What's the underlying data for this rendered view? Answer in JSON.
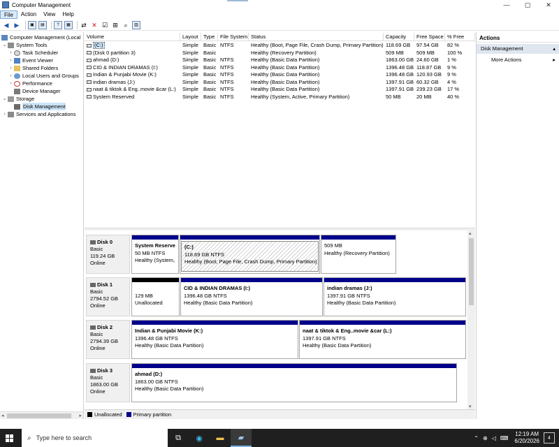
{
  "window": {
    "title": "Computer Management",
    "minimize": "—",
    "maximize": "▢",
    "close": "✕"
  },
  "menu": [
    "File",
    "Action",
    "View",
    "Help"
  ],
  "tree": {
    "root": "Computer Management (Local",
    "nodes": [
      {
        "label": "System Tools",
        "icon": "tools-icon"
      },
      {
        "label": "Task Scheduler",
        "icon": "clock-icon"
      },
      {
        "label": "Event Viewer",
        "icon": "event-viewer-icon"
      },
      {
        "label": "Shared Folders",
        "icon": "folder-icon"
      },
      {
        "label": "Local Users and Groups",
        "icon": "users-icon"
      },
      {
        "label": "Performance",
        "icon": "performance-icon"
      },
      {
        "label": "Device Manager",
        "icon": "device-manager-icon"
      },
      {
        "label": "Storage",
        "icon": "storage-icon"
      },
      {
        "label": "Disk Management",
        "icon": "disk-icon"
      },
      {
        "label": "Services and Applications",
        "icon": "services-icon"
      }
    ]
  },
  "volume_list": {
    "columns": [
      "Volume",
      "Layout",
      "Type",
      "File System",
      "Status",
      "Capacity",
      "Free Space",
      "% Free"
    ],
    "rows": [
      {
        "volume": "(C:)",
        "layout": "Simple",
        "type": "Basic",
        "fs": "NTFS",
        "status": "Healthy (Boot, Page File, Crash Dump, Primary Partition)",
        "capacity": "118.69 GB",
        "free": "97.54 GB",
        "pct": "82 %"
      },
      {
        "volume": "(Disk 0 partition 3)",
        "layout": "Simple",
        "type": "Basic",
        "fs": "",
        "status": "Healthy (Recovery Partition)",
        "capacity": "509 MB",
        "free": "509 MB",
        "pct": "100 %"
      },
      {
        "volume": "ahmad (D:)",
        "layout": "Simple",
        "type": "Basic",
        "fs": "NTFS",
        "status": "Healthy (Basic Data Partition)",
        "capacity": "1863.00 GB",
        "free": "24.60 GB",
        "pct": "1 %"
      },
      {
        "volume": "CID & INDIAN DRAMAS (I:)",
        "layout": "Simple",
        "type": "Basic",
        "fs": "NTFS",
        "status": "Healthy (Basic Data Partition)",
        "capacity": "1396.48 GB",
        "free": "118.87 GB",
        "pct": "9 %"
      },
      {
        "volume": "Indian & Punjabi Movie (K:)",
        "layout": "Simple",
        "type": "Basic",
        "fs": "NTFS",
        "status": "Healthy (Basic Data Partition)",
        "capacity": "1396.48 GB",
        "free": "120.93 GB",
        "pct": "9 %"
      },
      {
        "volume": "indian dramas (J:)",
        "layout": "Simple",
        "type": "Basic",
        "fs": "NTFS",
        "status": "Healthy (Basic Data Partition)",
        "capacity": "1397.91 GB",
        "free": "60.32 GB",
        "pct": "4 %"
      },
      {
        "volume": "naat & tiktok & Eng..movie &car (L:)",
        "layout": "Simple",
        "type": "Basic",
        "fs": "NTFS",
        "status": "Healthy (Basic Data Partition)",
        "capacity": "1397.91 GB",
        "free": "239.23 GB",
        "pct": "17 %"
      },
      {
        "volume": "System Reserved",
        "layout": "Simple",
        "type": "Basic",
        "fs": "NTFS",
        "status": "Healthy (System, Active, Primary Partition)",
        "capacity": "50 MB",
        "free": "20 MB",
        "pct": "40 %"
      }
    ]
  },
  "disks": [
    {
      "name": "Disk 0",
      "type": "Basic",
      "size": "119.24 GB",
      "state": "Online",
      "parts": [
        {
          "l1": "System Reserve",
          "l2": "50 MB NTFS",
          "l3": "Healthy (System,"
        },
        {
          "l1": "(C:)",
          "l2": "118.69 GB NTFS",
          "l3": "Healthy (Boot, Page File, Crash Dump, Primary Partition)"
        },
        {
          "l1": "",
          "l2": "509 MB",
          "l3": "Healthy (Recovery Partition)"
        }
      ]
    },
    {
      "name": "Disk 1",
      "type": "Basic",
      "size": "2794.52 GB",
      "state": "Online",
      "parts": [
        {
          "l1": "",
          "l2": "129 MB",
          "l3": "Unallocated"
        },
        {
          "l1": "CID & INDIAN DRAMAS  (I:)",
          "l2": "1396.48 GB NTFS",
          "l3": "Healthy (Basic Data Partition)"
        },
        {
          "l1": "indian dramas  (J:)",
          "l2": "1397.91 GB NTFS",
          "l3": "Healthy (Basic Data Partition)"
        }
      ]
    },
    {
      "name": "Disk 2",
      "type": "Basic",
      "size": "2794.39 GB",
      "state": "Online",
      "parts": [
        {
          "l1": "Indian & Punjabi Movie  (K:)",
          "l2": "1396.48 GB NTFS",
          "l3": "Healthy (Basic Data Partition)"
        },
        {
          "l1": "naat & tiktok & Eng..movie &car  (L:)",
          "l2": "1397.91 GB NTFS",
          "l3": "Healthy (Basic Data Partition)"
        }
      ]
    },
    {
      "name": "Disk 3",
      "type": "Basic",
      "size": "1863.00 GB",
      "state": "Online",
      "parts": [
        {
          "l1": "ahmad  (D:)",
          "l2": "1863.00 GB NTFS",
          "l3": "Healthy (Basic Data Partition)"
        }
      ]
    }
  ],
  "legend": {
    "unallocated": "Unallocated",
    "primary": "Primary partition",
    "unallocated_color": "#000000",
    "primary_color": "#00008a"
  },
  "actions": {
    "header": "Actions",
    "section": "Disk Management",
    "item": "More Actions"
  },
  "taskbar": {
    "search_placeholder": "Type here to search",
    "time": "12:19 AM",
    "date": "6/20/2026",
    "notifications": "4"
  }
}
